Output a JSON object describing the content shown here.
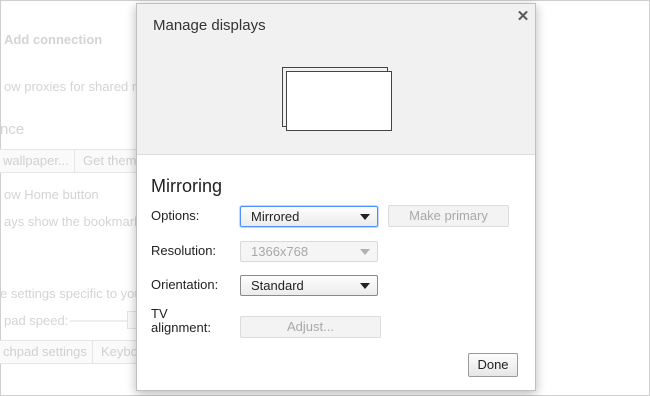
{
  "background": {
    "add_connection": "Add connection",
    "proxies_text": "ow proxies for shared ne",
    "appearance_heading": "nce",
    "wallpaper_button": "wallpaper...",
    "get_themes_button": "Get theme",
    "home_button_text": "ow Home button",
    "bookmarks_text": "ays show the bookmark",
    "device_settings_text": "e settings specific to you",
    "touchpad_speed_label": "pad speed:",
    "touchpad_settings_button": "chpad settings",
    "keyboard_button": "Keybo"
  },
  "dialog": {
    "title": "Manage displays",
    "close_symbol": "✕",
    "section_title": "Mirroring",
    "options": {
      "label": "Options:",
      "value": "Mirrored"
    },
    "make_primary_label": "Make primary",
    "resolution": {
      "label": "Resolution:",
      "value": "1366x768"
    },
    "orientation": {
      "label": "Orientation:",
      "value": "Standard"
    },
    "tv_alignment": {
      "label_line1": "TV",
      "label_line2": "alignment:",
      "button_label": "Adjust..."
    },
    "done_label": "Done"
  }
}
